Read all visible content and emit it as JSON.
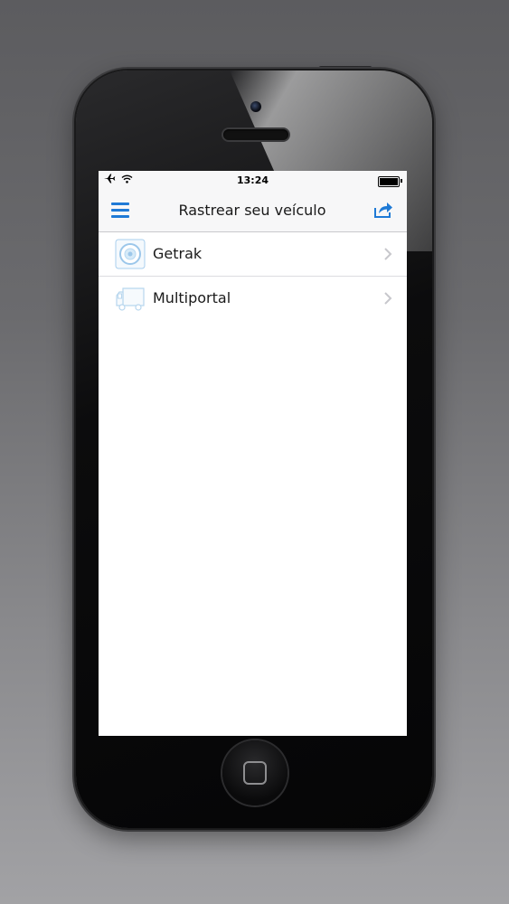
{
  "status_bar": {
    "time": "13:24",
    "icons": [
      "airplane-icon",
      "wifi-icon",
      "battery-icon"
    ]
  },
  "nav": {
    "title": "Rastrear seu veículo",
    "left_icon": "menu-icon",
    "right_icon": "share-icon"
  },
  "list": {
    "items": [
      {
        "label": "Getrak",
        "icon": "getrak-logo-icon"
      },
      {
        "label": "Multiportal",
        "icon": "truck-icon"
      }
    ]
  },
  "colors": {
    "accent": "#1f7ad6",
    "nav_bg": "#f7f7f8",
    "chevron": "#c7c7cc"
  }
}
